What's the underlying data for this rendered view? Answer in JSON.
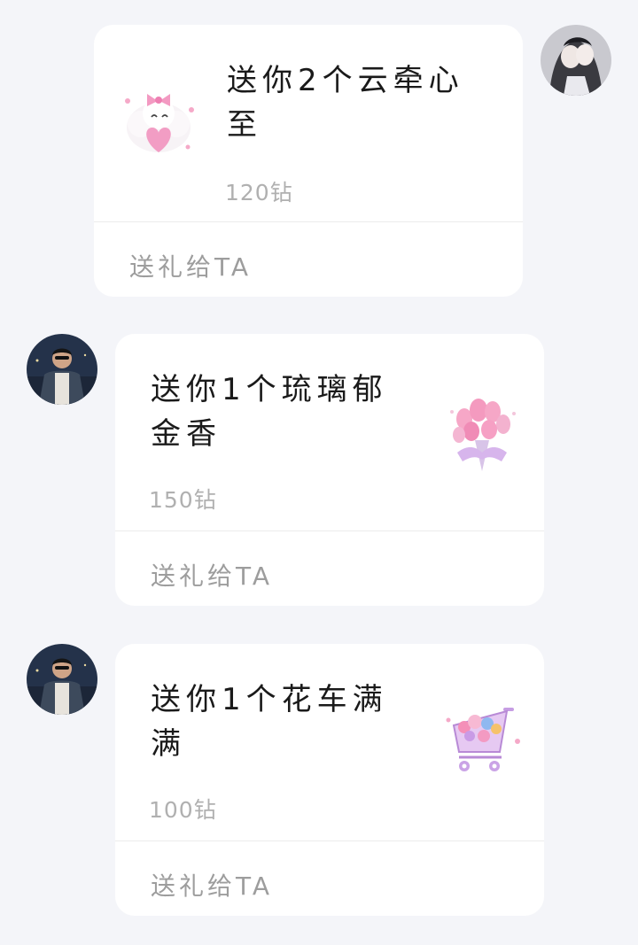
{
  "messages": [
    {
      "side": "right",
      "sender": "self",
      "gift_title": "送你2个云牵心至",
      "price": "120钻",
      "action_label": "送礼给TA",
      "gift_icon": "heart-cloud-icon"
    },
    {
      "side": "left",
      "sender": "other",
      "gift_title": "送你1个琉璃郁金香",
      "price": "150钻",
      "action_label": "送礼给TA",
      "gift_icon": "tulip-bouquet-icon"
    },
    {
      "side": "left",
      "sender": "other",
      "gift_title": "送你1个花车满满",
      "price": "100钻",
      "action_label": "送礼给TA",
      "gift_icon": "flower-cart-icon"
    }
  ],
  "colors": {
    "background": "#f4f5f9",
    "card": "#ffffff",
    "title": "#1a1a1a",
    "muted": "#9d9d9d"
  }
}
